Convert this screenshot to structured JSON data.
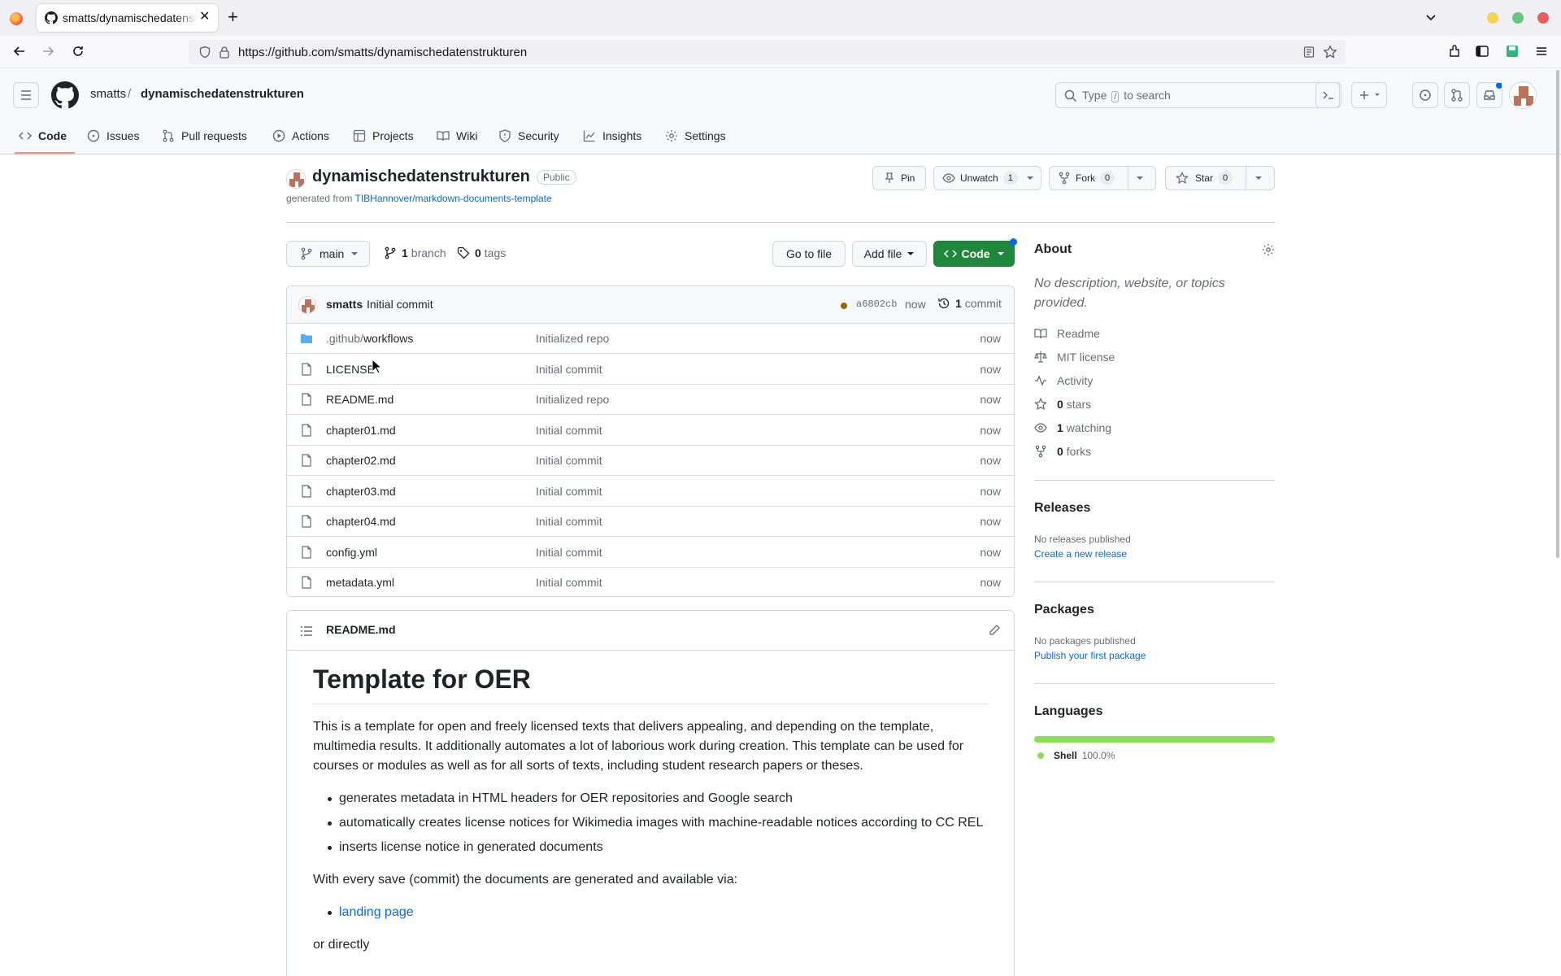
{
  "browser": {
    "tab_title": "smatts/dynamischedatenstrukturen",
    "url": "https://github.com/smatts/dynamischedatenstrukturen"
  },
  "header": {
    "owner": "smatts",
    "separator": "/",
    "repo": "dynamischedatenstrukturen",
    "search_prefix": "Type",
    "search_key": "/",
    "search_suffix": "to search"
  },
  "repo_nav": [
    {
      "label": "Code",
      "icon": "code-icon"
    },
    {
      "label": "Issues",
      "icon": "issue-icon"
    },
    {
      "label": "Pull requests",
      "icon": "pull-request-icon"
    },
    {
      "label": "Actions",
      "icon": "play-icon"
    },
    {
      "label": "Projects",
      "icon": "table-icon"
    },
    {
      "label": "Wiki",
      "icon": "book-icon"
    },
    {
      "label": "Security",
      "icon": "shield-icon"
    },
    {
      "label": "Insights",
      "icon": "graph-icon"
    },
    {
      "label": "Settings",
      "icon": "gear-icon"
    }
  ],
  "repo": {
    "name": "dynamischedatenstrukturen",
    "visibility": "Public",
    "generated_prefix": "generated from",
    "template_link": "TIBHannover/markdown-documents-template",
    "pin_label": "Pin",
    "unwatch_label": "Unwatch",
    "watch_count": "1",
    "fork_label": "Fork",
    "fork_count": "0",
    "star_label": "Star",
    "star_count": "0"
  },
  "branch_bar": {
    "branch": "main",
    "branch_count": "1",
    "branch_word": "branch",
    "tag_count": "0",
    "tag_word": "tags",
    "go_to_file": "Go to file",
    "add_file": "Add file",
    "code": "Code"
  },
  "latest_commit": {
    "author": "smatts",
    "message": "Initial commit",
    "sha": "a6802cb",
    "time": "now",
    "count": "1",
    "count_word": "commit"
  },
  "files": [
    {
      "prefix": ".github/",
      "name": "workflows",
      "type": "folder",
      "message": "Initialized repo",
      "time": "now"
    },
    {
      "prefix": "",
      "name": "LICENSE",
      "type": "file",
      "message": "Initial commit",
      "time": "now"
    },
    {
      "prefix": "",
      "name": "README.md",
      "type": "file",
      "message": "Initialized repo",
      "time": "now"
    },
    {
      "prefix": "",
      "name": "chapter01.md",
      "type": "file",
      "message": "Initial commit",
      "time": "now"
    },
    {
      "prefix": "",
      "name": "chapter02.md",
      "type": "file",
      "message": "Initial commit",
      "time": "now"
    },
    {
      "prefix": "",
      "name": "chapter03.md",
      "type": "file",
      "message": "Initial commit",
      "time": "now"
    },
    {
      "prefix": "",
      "name": "chapter04.md",
      "type": "file",
      "message": "Initial commit",
      "time": "now"
    },
    {
      "prefix": "",
      "name": "config.yml",
      "type": "file",
      "message": "Initial commit",
      "time": "now"
    },
    {
      "prefix": "",
      "name": "metadata.yml",
      "type": "file",
      "message": "Initial commit",
      "time": "now"
    }
  ],
  "readme": {
    "filename": "README.md",
    "heading": "Template for OER",
    "intro": "This is a template for open and freely licensed texts that delivers appealing, and depending on the template, multimedia results. It additionally automates a lot of laborious work during creation. This template can be used for courses or modules as well as for all sorts of texts, including student research papers or theses.",
    "features": [
      "generates metadata in HTML headers for OER repositories and Google search",
      "automatically creates license notices for Wikimedia images with machine-readable notices according to CC REL",
      "inserts license notice in generated documents"
    ],
    "save_text": "With every save (commit) the documents are generated and available via:",
    "link": "landing page",
    "directly": "or directly"
  },
  "about": {
    "title": "About",
    "description": "No description, website, or topics provided.",
    "readme": "Readme",
    "license": "MIT license",
    "activity": "Activity",
    "stars_count": "0",
    "stars_word": "stars",
    "watching_count": "1",
    "watching_word": "watching",
    "forks_count": "0",
    "forks_word": "forks"
  },
  "releases": {
    "title": "Releases",
    "empty": "No releases published",
    "link": "Create a new release"
  },
  "packages": {
    "title": "Packages",
    "empty": "No packages published",
    "link": "Publish your first package"
  },
  "languages": {
    "title": "Languages",
    "name": "Shell",
    "percent": "100.0%",
    "color": "#89e051",
    "share": 100
  }
}
